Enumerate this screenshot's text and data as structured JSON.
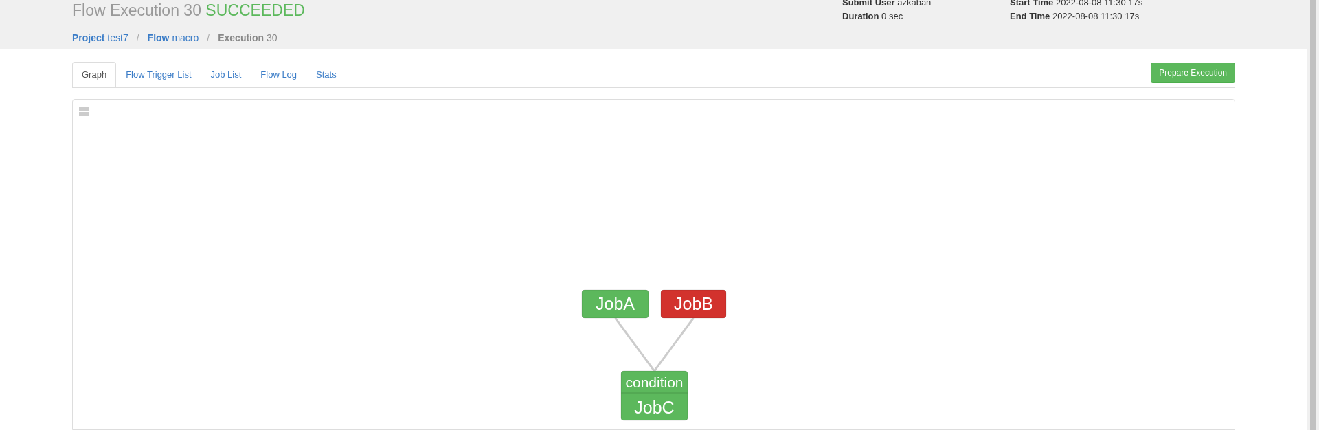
{
  "header": {
    "title": "Flow Execution 30",
    "status": "SUCCEEDED",
    "info": [
      {
        "label": "Submit User",
        "value": "azkaban"
      },
      {
        "label": "Start Time",
        "value": "2022-08-08 11:30 17s"
      },
      {
        "label": "Duration",
        "value": "0 sec"
      },
      {
        "label": "End Time",
        "value": "2022-08-08 11:30 17s"
      }
    ]
  },
  "breadcrumb": [
    {
      "label": "Project",
      "value": "test7",
      "link": true
    },
    {
      "separator": "/",
      "label": "Flow",
      "value": "macro",
      "link": true
    },
    {
      "separator": "/",
      "label": "Execution",
      "value": "30",
      "link": false
    }
  ],
  "tabs": [
    {
      "label": "Graph",
      "selected": true
    },
    {
      "label": "Flow Trigger List",
      "selected": false
    },
    {
      "label": "Job List",
      "selected": false
    },
    {
      "label": "Flow Log",
      "selected": false
    },
    {
      "label": "Stats",
      "selected": false
    }
  ],
  "prepare_button": "Prepare Execution",
  "graph": {
    "nodes": [
      {
        "name": "JobA",
        "color": "#5cb85c"
      },
      {
        "name": "JobB",
        "color": "#d2322d"
      },
      {
        "name": "JobC",
        "color": "#5cb85c",
        "condition": "condition"
      }
    ]
  }
}
